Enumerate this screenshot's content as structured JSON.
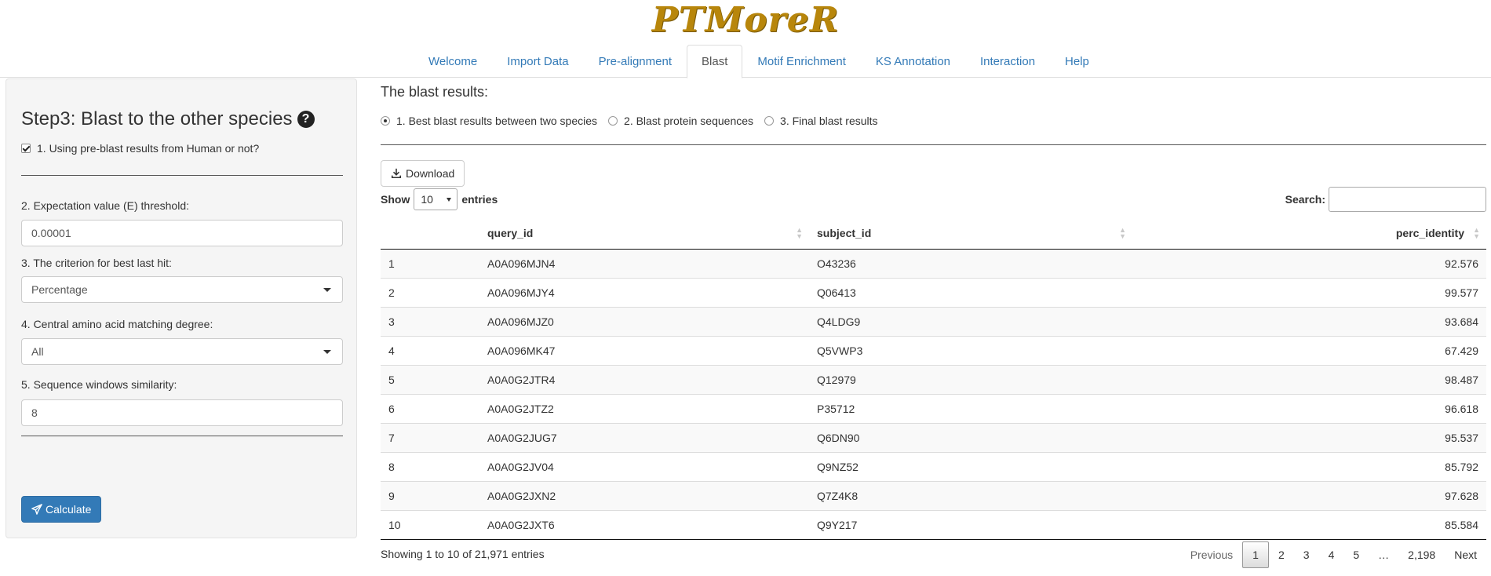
{
  "app": {
    "logo": "PTMoreR"
  },
  "nav": {
    "tabs": [
      {
        "label": "Welcome"
      },
      {
        "label": "Import Data"
      },
      {
        "label": "Pre-alignment"
      },
      {
        "label": "Blast",
        "active": true
      },
      {
        "label": "Motif Enrichment"
      },
      {
        "label": "KS Annotation"
      },
      {
        "label": "Interaction"
      },
      {
        "label": "Help"
      }
    ]
  },
  "sidebar": {
    "title": "Step3: Blast to the other species",
    "help_icon": "question-circle-icon",
    "checkbox_label": "1. Using pre-blast results from Human or not?",
    "checkbox_checked": true,
    "evalue_label": "2. Expectation value (E) threshold:",
    "evalue_value": "0.00001",
    "criterion_label": "3. The criterion for best last hit:",
    "criterion_value": "Percentage",
    "central_label": "4. Central amino acid matching degree:",
    "central_value": "All",
    "window_label": "5. Sequence windows similarity:",
    "window_value": "8",
    "calculate_label": "Calculate"
  },
  "main": {
    "title": "The blast results:",
    "radios": [
      {
        "label": "1. Best blast results between two species",
        "checked": true
      },
      {
        "label": "2. Blast protein sequences",
        "checked": false
      },
      {
        "label": "3. Final blast results",
        "checked": false
      }
    ],
    "download_label": "Download",
    "show_label": "Show",
    "page_length": "10",
    "entries_label": "entries",
    "search_label": "Search:",
    "search_value": ""
  },
  "table": {
    "columns": [
      "",
      "query_id",
      "subject_id",
      "perc_identity"
    ],
    "rows": [
      [
        "1",
        "A0A096MJN4",
        "O43236",
        "92.576"
      ],
      [
        "2",
        "A0A096MJY4",
        "Q06413",
        "99.577"
      ],
      [
        "3",
        "A0A096MJZ0",
        "Q4LDG9",
        "93.684"
      ],
      [
        "4",
        "A0A096MK47",
        "Q5VWP3",
        "67.429"
      ],
      [
        "5",
        "A0A0G2JTR4",
        "Q12979",
        "98.487"
      ],
      [
        "6",
        "A0A0G2JTZ2",
        "P35712",
        "96.618"
      ],
      [
        "7",
        "A0A0G2JUG7",
        "Q6DN90",
        "95.537"
      ],
      [
        "8",
        "A0A0G2JV04",
        "Q9NZ52",
        "85.792"
      ],
      [
        "9",
        "A0A0G2JXN2",
        "Q7Z4K8",
        "97.628"
      ],
      [
        "10",
        "A0A0G2JXT6",
        "Q9Y217",
        "85.584"
      ]
    ]
  },
  "footer": {
    "info": "Showing 1 to 10 of 21,971 entries",
    "pages": [
      "Previous",
      "1",
      "2",
      "3",
      "4",
      "5",
      "…",
      "2,198",
      "Next"
    ],
    "current_page": "1"
  }
}
